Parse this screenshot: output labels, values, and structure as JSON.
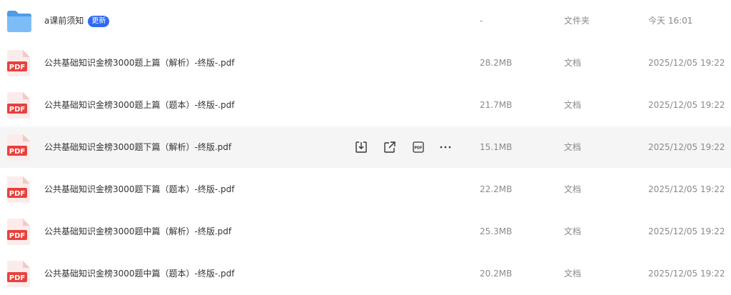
{
  "files": [
    {
      "name": "a课前须知",
      "badge": "更新",
      "size": "-",
      "type": "文件夹",
      "time": "今天 16:01",
      "icon": "folder-icon"
    },
    {
      "name": "公共基础知识金榜3000题上篇（解析）-终版-.pdf",
      "size": "28.2MB",
      "type": "文档",
      "time": "2025/12/05 19:22",
      "icon": "pdf-file-icon"
    },
    {
      "name": "公共基础知识金榜3000题上篇（题本）-终版-.pdf",
      "size": "21.7MB",
      "type": "文档",
      "time": "2025/12/05 19:22",
      "icon": "pdf-file-icon"
    },
    {
      "name": "公共基础知识金榜3000题下篇（解析）-终版.pdf",
      "size": "15.1MB",
      "type": "文档",
      "time": "2025/12/05 19:22",
      "icon": "pdf-file-icon"
    },
    {
      "name": "公共基础知识金榜3000题下篇（题本）-终版-.pdf",
      "size": "22.2MB",
      "type": "文档",
      "time": "2025/12/05 19:22",
      "icon": "pdf-file-icon"
    },
    {
      "name": "公共基础知识金榜3000题中篇（解析）-终版.pdf",
      "size": "25.3MB",
      "type": "文档",
      "time": "2025/12/05 19:22",
      "icon": "pdf-file-icon"
    },
    {
      "name": "公共基础知识金榜3000题中篇（题本）-终版-.pdf",
      "size": "20.2MB",
      "type": "文档",
      "time": "2025/12/05 19:22",
      "icon": "pdf-file-icon"
    }
  ],
  "pdf_icon_label": "PDF",
  "pdf_action_label": "PDF",
  "row_actions": [
    "download-icon",
    "share-icon",
    "pdf-convert-icon",
    "more-icon"
  ],
  "colors": {
    "pdf_red": "#e8413c",
    "folder_blue": "#5aa6f0",
    "badge_blue": "#2f6bf2",
    "hover_bg": "#f5f5f6"
  }
}
